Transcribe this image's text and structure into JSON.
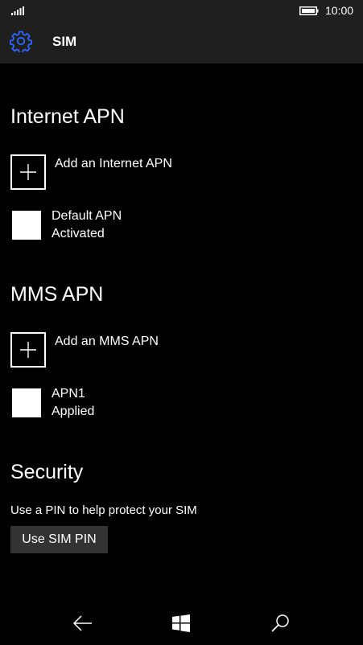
{
  "status_bar": {
    "signal_icon": "signal-strength-icon",
    "battery_icon": "battery-icon",
    "time": "10:00"
  },
  "header": {
    "icon": "gear-icon",
    "icon_color": "#2b66ff",
    "title": "SIM"
  },
  "internet_apn": {
    "title": "Internet APN",
    "add_label": "Add an Internet APN",
    "items": [
      {
        "name": "Default APN",
        "status": "Activated"
      }
    ]
  },
  "mms_apn": {
    "title": "MMS APN",
    "add_label": "Add an MMS APN",
    "items": [
      {
        "name": "APN1",
        "status": "Applied"
      }
    ]
  },
  "security": {
    "title": "Security",
    "description": "Use a PIN to help protect your SIM",
    "button_label": "Use SIM PIN"
  },
  "nav_bar": {
    "back_icon": "back-arrow-icon",
    "home_icon": "windows-logo-icon",
    "search_icon": "search-icon"
  }
}
